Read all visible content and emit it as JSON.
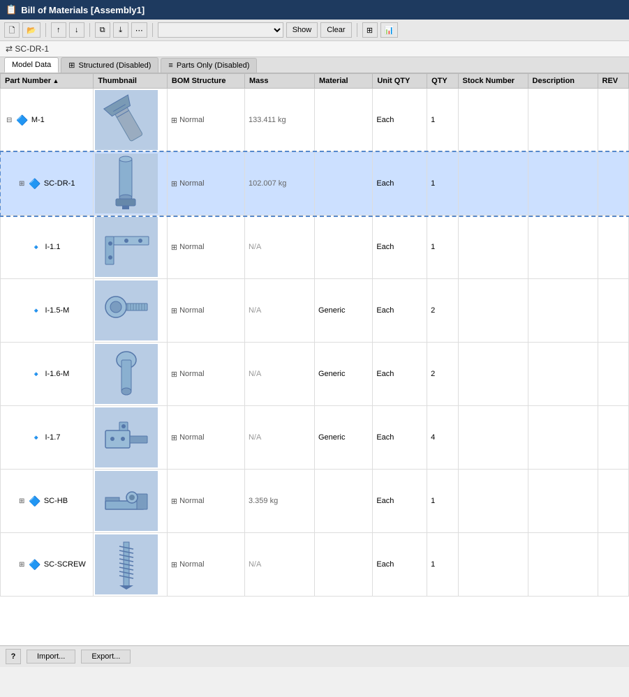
{
  "window": {
    "title": "Bill of Materials [Assembly1]"
  },
  "toolbar": {
    "search_placeholder": "",
    "show_label": "Show",
    "clear_label": "Clear"
  },
  "path": "SC-DR-1",
  "tabs": [
    {
      "id": "model-data",
      "label": "Model Data",
      "active": true
    },
    {
      "id": "structured",
      "label": "Structured (Disabled)",
      "active": false
    },
    {
      "id": "parts-only",
      "label": "Parts Only (Disabled)",
      "active": false
    }
  ],
  "table": {
    "columns": [
      {
        "id": "partnum",
        "label": "Part Number",
        "sort": "asc"
      },
      {
        "id": "thumb",
        "label": "Thumbnail"
      },
      {
        "id": "bom",
        "label": "BOM Structure"
      },
      {
        "id": "mass",
        "label": "Mass"
      },
      {
        "id": "material",
        "label": "Material"
      },
      {
        "id": "uqty",
        "label": "Unit QTY"
      },
      {
        "id": "qty",
        "label": "QTY"
      },
      {
        "id": "stock",
        "label": "Stock Number"
      },
      {
        "id": "desc",
        "label": "Description"
      },
      {
        "id": "rev",
        "label": "REV"
      }
    ],
    "rows": [
      {
        "id": "row-m1",
        "indent": 0,
        "expandable": true,
        "expanded": true,
        "part_number": "M-1",
        "bom_structure": "Normal",
        "mass": "133.411 kg",
        "material": "",
        "unit_qty": "Each",
        "qty": "1",
        "stock": "",
        "description": "",
        "rev": "",
        "selected": false,
        "thumb_type": "bolt"
      },
      {
        "id": "row-scdr1",
        "indent": 1,
        "expandable": true,
        "expanded": false,
        "part_number": "SC-DR-1",
        "bom_structure": "Normal",
        "mass": "102.007 kg",
        "material": "",
        "unit_qty": "Each",
        "qty": "1",
        "stock": "",
        "description": "",
        "rev": "",
        "selected": true,
        "thumb_type": "cylinder-assembly"
      },
      {
        "id": "row-i11",
        "indent": 1,
        "expandable": false,
        "expanded": false,
        "part_number": "I-1.1",
        "bom_structure": "Normal",
        "mass": "N/A",
        "material": "",
        "unit_qty": "Each",
        "qty": "1",
        "stock": "",
        "description": "",
        "rev": "",
        "selected": false,
        "thumb_type": "bracket"
      },
      {
        "id": "row-i15m",
        "indent": 1,
        "expandable": false,
        "expanded": false,
        "part_number": "I-1.5-M",
        "bom_structure": "Normal",
        "mass": "N/A",
        "material": "Generic",
        "unit_qty": "Each",
        "qty": "2",
        "stock": "",
        "description": "",
        "rev": "",
        "selected": false,
        "thumb_type": "bolt-screw"
      },
      {
        "id": "row-i16m",
        "indent": 1,
        "expandable": false,
        "expanded": false,
        "part_number": "I-1.6-M",
        "bom_structure": "Normal",
        "mass": "N/A",
        "material": "Generic",
        "unit_qty": "Each",
        "qty": "2",
        "stock": "",
        "description": "",
        "rev": "",
        "selected": false,
        "thumb_type": "pin"
      },
      {
        "id": "row-i17",
        "indent": 1,
        "expandable": false,
        "expanded": false,
        "part_number": "I-1.7",
        "bom_structure": "Normal",
        "mass": "N/A",
        "material": "Generic",
        "unit_qty": "Each",
        "qty": "4",
        "stock": "",
        "description": "",
        "rev": "",
        "selected": false,
        "thumb_type": "bracket-clip"
      },
      {
        "id": "row-schb",
        "indent": 1,
        "expandable": true,
        "expanded": false,
        "part_number": "SC-HB",
        "bom_structure": "Normal",
        "mass": "3.359 kg",
        "material": "",
        "unit_qty": "Each",
        "qty": "1",
        "stock": "",
        "description": "",
        "rev": "",
        "selected": false,
        "thumb_type": "hb-assembly"
      },
      {
        "id": "row-scscrew",
        "indent": 1,
        "expandable": true,
        "expanded": false,
        "part_number": "SC-SCREW",
        "bom_structure": "Normal",
        "mass": "N/A",
        "material": "",
        "unit_qty": "Each",
        "qty": "1",
        "stock": "",
        "description": "",
        "rev": "",
        "selected": false,
        "thumb_type": "screw"
      }
    ]
  },
  "footer": {
    "import_label": "Import...",
    "export_label": "Export...",
    "help_label": "?"
  }
}
